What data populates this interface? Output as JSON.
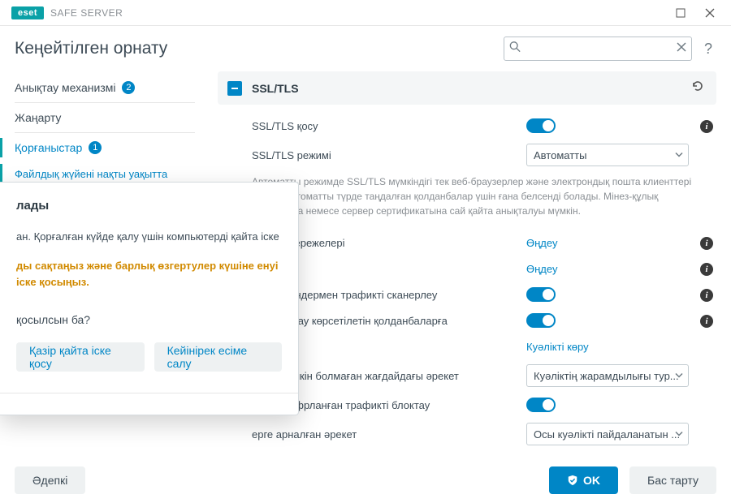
{
  "app": {
    "brand_badge": "eset",
    "brand_name": "SAFE SERVER"
  },
  "header": {
    "title": "Кеңейтілген орнату",
    "search_placeholder": "",
    "help_label": "?"
  },
  "sidebar": {
    "items": [
      {
        "label": "Анықтау механизмі",
        "badge": "2",
        "active": false
      },
      {
        "label": "Жаңарту",
        "active": false
      },
      {
        "label": "Қорғаныстар",
        "badge": "1",
        "active": true
      },
      {
        "label": "Файлдық жүйені нақты уақытта қорғау",
        "active": true,
        "sub": true
      }
    ]
  },
  "section": {
    "title": "SSL/TLS",
    "rows": {
      "enable": {
        "label": "SSL/TLS қосу"
      },
      "mode": {
        "label": "SSL/TLS режимі",
        "value": "Автоматты"
      },
      "desc": "Автоматты режимде SSL/TLS мүмкіндігі тек веб-браузерлер және электрондық пошта клиенттері сияқты автоматты түрде таңдалған қолданбалар үшін ғана белсенді болады. Мінез-құлық қолданбаға немесе сервер сертификатына сай қайта анықталуы мүмкін.",
      "rules": {
        "label": "ап шығу ережелері",
        "link": "Өңдеу"
      },
      "edit2": {
        "link": "Өңдеу"
      },
      "domain": {
        "label": "ген домендермен трафикті сканерлеу"
      },
      "support": {
        "label": "лігін қолдау көрсетілетін қолданбаларға"
      },
      "cert": {
        "link": "Куәлікті көру"
      },
      "nosetup": {
        "label": "›нату мүмкін болмаған жағдайдағы әрекет",
        "value": "Куәліктің жарамдылығы тур..."
      },
      "block": {
        "label": "қылы шифрланған трафикті блоктау"
      },
      "action": {
        "label": "ерге арналған әрекет",
        "value": "Осы куәлікті пайдаланатын ..."
      }
    }
  },
  "footer": {
    "default": "Әдепкі",
    "ok": "OK",
    "cancel": "Бас тарту"
  },
  "modal": {
    "title": "лады",
    "text": "ан. Қорғалған күйде қалу үшін компьютерді қайта іске",
    "warn": "ды сақтаңыз және барлық өзгертулер күшіне енуі іске қосыңыз.",
    "sub": "қосылсын ба?",
    "primary": "Қазір қайта іске қосу",
    "secondary": "Кейінірек есіме салу"
  }
}
